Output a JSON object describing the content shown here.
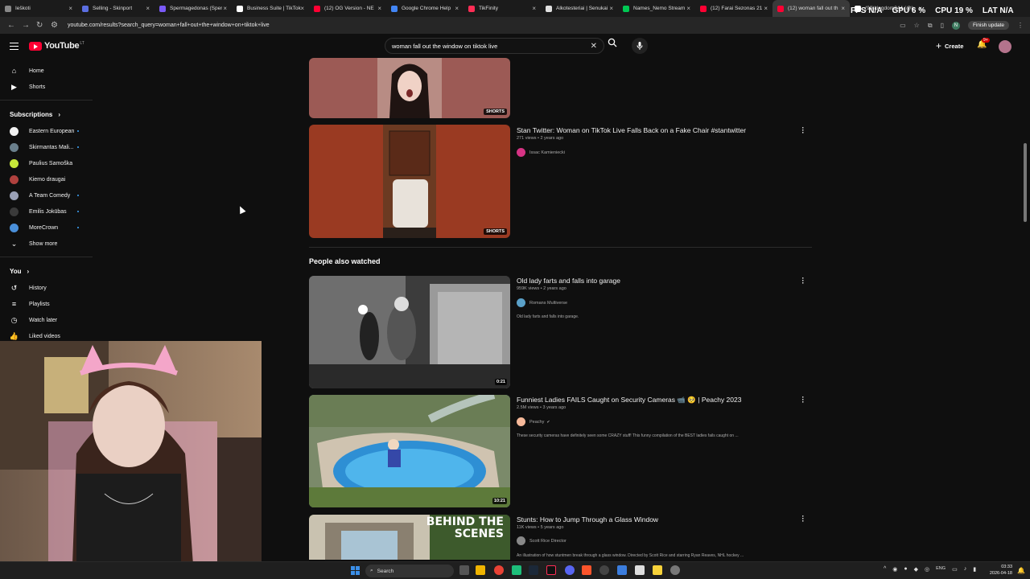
{
  "browser": {
    "tabs": [
      {
        "label": "Ieškoti",
        "color": "#888888"
      },
      {
        "label": "Selling - Skinport",
        "color": "#5b6ee1"
      },
      {
        "label": "Spermagedonas (Sper",
        "color": "#7a5af8"
      },
      {
        "label": "Business Suite | TikTok",
        "color": "#ffffff"
      },
      {
        "label": "(12) OG Version - NE",
        "color": "#ff0033"
      },
      {
        "label": "Google Chrome Help",
        "color": "#4285f4"
      },
      {
        "label": "TikFinity",
        "color": "#ff2d55"
      },
      {
        "label": "Alkotesteriai | Senukai",
        "color": "#e0e0e0"
      },
      {
        "label": "Names_Nemo Stream",
        "color": "#00c853"
      },
      {
        "label": "(12) Farai Sezonas 21",
        "color": "#ff0033"
      },
      {
        "label": "(12) woman fall out th",
        "color": "#ff0033"
      },
      {
        "label": "(99)kingdom244 (@k",
        "color": "#ffffff"
      }
    ],
    "url": "youtube.com/results?search_query=woman+fall+out+the+window+on+tiktok+live",
    "finish_update": "Finish update"
  },
  "overlay": {
    "fps_label": "FPS",
    "fps_value": "N/A",
    "gpu_label": "GPU",
    "gpu_value": "6",
    "cpu_label": "CPU",
    "cpu_value": "19",
    "lat_label": "LAT",
    "lat_value": "N/A"
  },
  "youtube": {
    "logo": "YouTube",
    "logo_country": "LT",
    "search_value": "woman fall out the window on tiktok live",
    "create_label": "Create",
    "notif_count": "9+"
  },
  "sidebar": {
    "main": [
      {
        "label": "Home",
        "icon": "home-icon"
      },
      {
        "label": "Shorts",
        "icon": "shorts-icon"
      }
    ],
    "subscriptions_title": "Subscriptions",
    "subscriptions": [
      {
        "label": "Eastern European",
        "color": "#f2f2f2",
        "dot": true
      },
      {
        "label": "Skirmantas Mali...",
        "color": "#6a7f8c",
        "dot": true
      },
      {
        "label": "Paulius Samoška",
        "color": "#c7e83a",
        "dot": false
      },
      {
        "label": "Kiemo draugai",
        "color": "#b0413e",
        "dot": false
      },
      {
        "label": "A Team Comedy",
        "color": "#9aa0b5",
        "dot": true
      },
      {
        "label": "Emilis Jokūbas",
        "color": "#3a3a3a",
        "dot": true
      },
      {
        "label": "MoreCrown",
        "color": "#4a8fd9",
        "dot": true
      }
    ],
    "show_more": "Show more",
    "you_title": "You",
    "you_items": [
      {
        "label": "History",
        "icon": "history-icon"
      },
      {
        "label": "Playlists",
        "icon": "playlists-icon"
      },
      {
        "label": "Watch later",
        "icon": "watch-later-icon"
      },
      {
        "label": "Liked videos",
        "icon": "liked-videos-icon"
      }
    ]
  },
  "results": {
    "short1": {
      "badge": "SHORTS"
    },
    "short2": {
      "title": "Stan Twitter: Woman on TikTok Live Falls Back on a Fake Chair #stantwitter",
      "meta": "271 views • 2 years ago",
      "channel": "Issac Kamieniecki",
      "badge": "SHORTS"
    },
    "section_title": "People also watched",
    "videos": [
      {
        "title": "Old lady farts and falls into garage",
        "meta": "959K views • 2 years ago",
        "channel": "Romans Multiverse",
        "desc": "Old lady farts and falls into garage.",
        "duration": "0:21",
        "channel_color": "#5aa0c8"
      },
      {
        "title": "Funniest Ladies FAILS Caught on Security Cameras 📹 🥺 | Peachy 2023",
        "meta": "2.5M views • 3 years ago",
        "channel": "Peachy",
        "desc": "These security cameras have definitely seen some CRAZY stuff! This funny compilation of the BEST ladies fails caught on ...",
        "duration": "10:21",
        "channel_color": "#f6b99a"
      },
      {
        "title": "Stunts: How to Jump Through a Glass Window",
        "meta": "11K views • 5 years ago",
        "channel": "Scott Rice Director",
        "desc": "An illustration of how stuntmen break through a glass window. Directed by Scott Rice and starring Ryan Reaves, NHL hockey ...",
        "thumb_text": "BEHIND THE SCENES",
        "channel_color": "#888888"
      }
    ]
  },
  "taskbar": {
    "search_label": "Search",
    "lang": "ENG",
    "time": "03:33",
    "date": "2026-04-18"
  }
}
